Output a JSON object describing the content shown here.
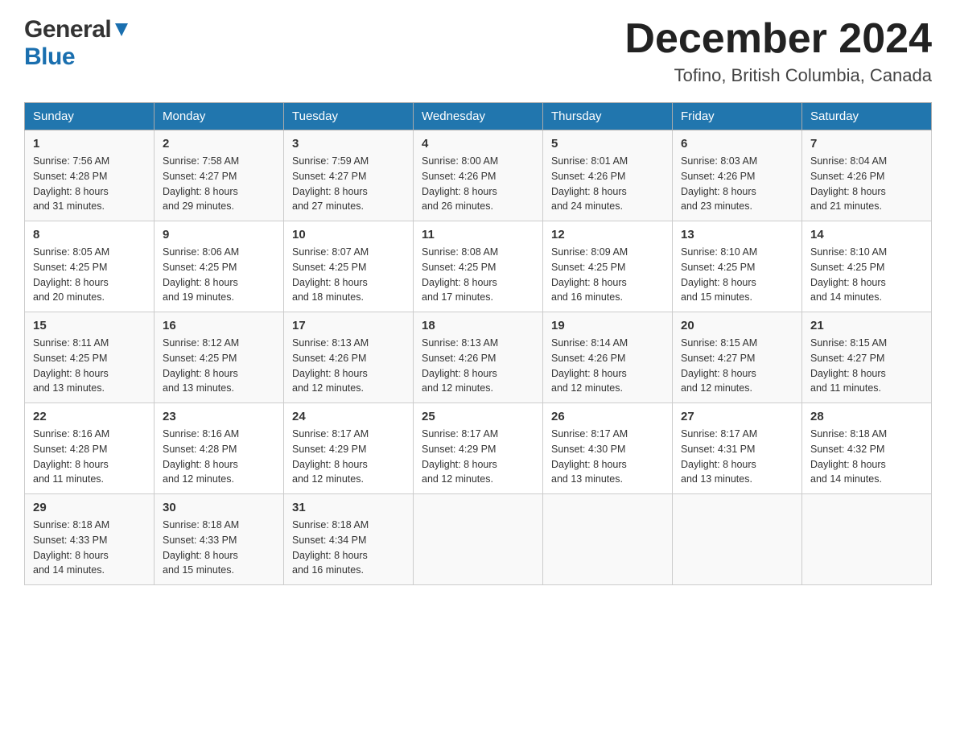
{
  "header": {
    "logo_general": "General",
    "logo_blue": "Blue",
    "month_title": "December 2024",
    "location": "Tofino, British Columbia, Canada"
  },
  "days_of_week": [
    "Sunday",
    "Monday",
    "Tuesday",
    "Wednesday",
    "Thursday",
    "Friday",
    "Saturday"
  ],
  "weeks": [
    [
      {
        "day": "1",
        "sunrise": "7:56 AM",
        "sunset": "4:28 PM",
        "daylight": "8 hours and 31 minutes."
      },
      {
        "day": "2",
        "sunrise": "7:58 AM",
        "sunset": "4:27 PM",
        "daylight": "8 hours and 29 minutes."
      },
      {
        "day": "3",
        "sunrise": "7:59 AM",
        "sunset": "4:27 PM",
        "daylight": "8 hours and 27 minutes."
      },
      {
        "day": "4",
        "sunrise": "8:00 AM",
        "sunset": "4:26 PM",
        "daylight": "8 hours and 26 minutes."
      },
      {
        "day": "5",
        "sunrise": "8:01 AM",
        "sunset": "4:26 PM",
        "daylight": "8 hours and 24 minutes."
      },
      {
        "day": "6",
        "sunrise": "8:03 AM",
        "sunset": "4:26 PM",
        "daylight": "8 hours and 23 minutes."
      },
      {
        "day": "7",
        "sunrise": "8:04 AM",
        "sunset": "4:26 PM",
        "daylight": "8 hours and 21 minutes."
      }
    ],
    [
      {
        "day": "8",
        "sunrise": "8:05 AM",
        "sunset": "4:25 PM",
        "daylight": "8 hours and 20 minutes."
      },
      {
        "day": "9",
        "sunrise": "8:06 AM",
        "sunset": "4:25 PM",
        "daylight": "8 hours and 19 minutes."
      },
      {
        "day": "10",
        "sunrise": "8:07 AM",
        "sunset": "4:25 PM",
        "daylight": "8 hours and 18 minutes."
      },
      {
        "day": "11",
        "sunrise": "8:08 AM",
        "sunset": "4:25 PM",
        "daylight": "8 hours and 17 minutes."
      },
      {
        "day": "12",
        "sunrise": "8:09 AM",
        "sunset": "4:25 PM",
        "daylight": "8 hours and 16 minutes."
      },
      {
        "day": "13",
        "sunrise": "8:10 AM",
        "sunset": "4:25 PM",
        "daylight": "8 hours and 15 minutes."
      },
      {
        "day": "14",
        "sunrise": "8:10 AM",
        "sunset": "4:25 PM",
        "daylight": "8 hours and 14 minutes."
      }
    ],
    [
      {
        "day": "15",
        "sunrise": "8:11 AM",
        "sunset": "4:25 PM",
        "daylight": "8 hours and 13 minutes."
      },
      {
        "day": "16",
        "sunrise": "8:12 AM",
        "sunset": "4:25 PM",
        "daylight": "8 hours and 13 minutes."
      },
      {
        "day": "17",
        "sunrise": "8:13 AM",
        "sunset": "4:26 PM",
        "daylight": "8 hours and 12 minutes."
      },
      {
        "day": "18",
        "sunrise": "8:13 AM",
        "sunset": "4:26 PM",
        "daylight": "8 hours and 12 minutes."
      },
      {
        "day": "19",
        "sunrise": "8:14 AM",
        "sunset": "4:26 PM",
        "daylight": "8 hours and 12 minutes."
      },
      {
        "day": "20",
        "sunrise": "8:15 AM",
        "sunset": "4:27 PM",
        "daylight": "8 hours and 12 minutes."
      },
      {
        "day": "21",
        "sunrise": "8:15 AM",
        "sunset": "4:27 PM",
        "daylight": "8 hours and 11 minutes."
      }
    ],
    [
      {
        "day": "22",
        "sunrise": "8:16 AM",
        "sunset": "4:28 PM",
        "daylight": "8 hours and 11 minutes."
      },
      {
        "day": "23",
        "sunrise": "8:16 AM",
        "sunset": "4:28 PM",
        "daylight": "8 hours and 12 minutes."
      },
      {
        "day": "24",
        "sunrise": "8:17 AM",
        "sunset": "4:29 PM",
        "daylight": "8 hours and 12 minutes."
      },
      {
        "day": "25",
        "sunrise": "8:17 AM",
        "sunset": "4:29 PM",
        "daylight": "8 hours and 12 minutes."
      },
      {
        "day": "26",
        "sunrise": "8:17 AM",
        "sunset": "4:30 PM",
        "daylight": "8 hours and 13 minutes."
      },
      {
        "day": "27",
        "sunrise": "8:17 AM",
        "sunset": "4:31 PM",
        "daylight": "8 hours and 13 minutes."
      },
      {
        "day": "28",
        "sunrise": "8:18 AM",
        "sunset": "4:32 PM",
        "daylight": "8 hours and 14 minutes."
      }
    ],
    [
      {
        "day": "29",
        "sunrise": "8:18 AM",
        "sunset": "4:33 PM",
        "daylight": "8 hours and 14 minutes."
      },
      {
        "day": "30",
        "sunrise": "8:18 AM",
        "sunset": "4:33 PM",
        "daylight": "8 hours and 15 minutes."
      },
      {
        "day": "31",
        "sunrise": "8:18 AM",
        "sunset": "4:34 PM",
        "daylight": "8 hours and 16 minutes."
      },
      null,
      null,
      null,
      null
    ]
  ]
}
